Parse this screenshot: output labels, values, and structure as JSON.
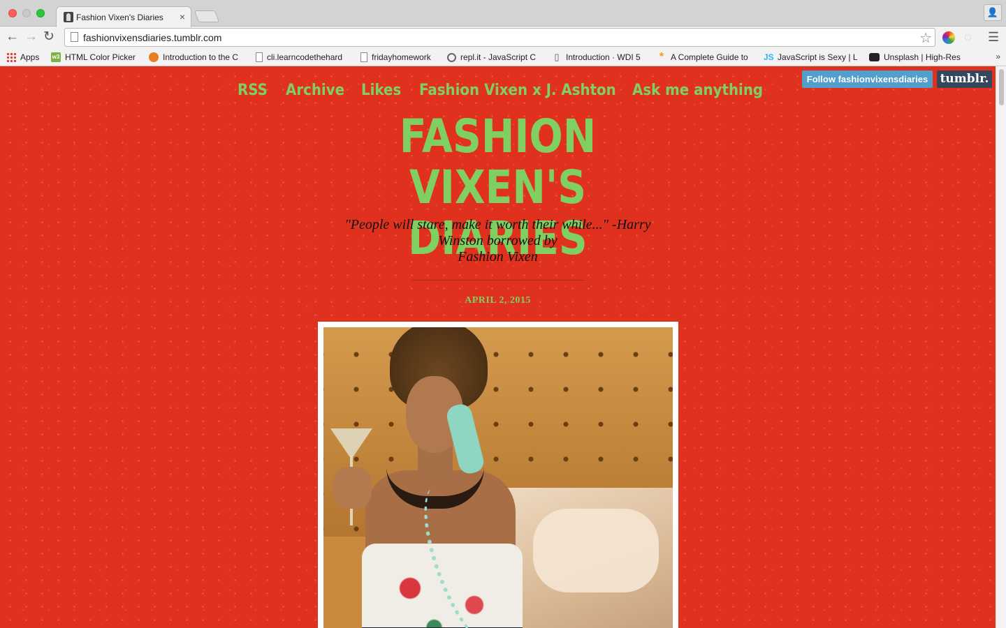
{
  "browser": {
    "tab_title": "Fashion Vixen's Diaries",
    "tab_close": "×",
    "url": "fashionvixensdiaries.tumblr.com",
    "back_glyph": "←",
    "forward_glyph": "→",
    "reload_glyph": "↻",
    "star_glyph": "☆",
    "menu_glyph": "☰",
    "profile_glyph": "👤",
    "bookmarks_more": "»",
    "bookmarks": [
      {
        "label": "Apps",
        "icon": "apps-grid-icon"
      },
      {
        "label": "HTML Color Picker",
        "icon": "w3schools-icon"
      },
      {
        "label": "Introduction to the C",
        "icon": "orange-circle-icon"
      },
      {
        "label": "cli.learncodethehard",
        "icon": "page-icon"
      },
      {
        "label": "fridayhomework",
        "icon": "page-icon"
      },
      {
        "label": "repl.it - JavaScript C",
        "icon": "repl-icon"
      },
      {
        "label": "Introduction · WDI 5",
        "icon": "book-icon"
      },
      {
        "label": "A Complete Guide to",
        "icon": "asterisk-icon"
      },
      {
        "label": "JavaScript is Sexy | L",
        "icon": "js-icon"
      },
      {
        "label": "Unsplash | High-Res",
        "icon": "camera-icon"
      }
    ]
  },
  "tumblr_controls": {
    "follow_label": "Follow fashionvixensdiaries",
    "tumblr_label": "tumblr."
  },
  "blog": {
    "nav": [
      "RSS",
      "Archive",
      "Likes",
      "Fashion Vixen x J. Ashton",
      "Ask me anything"
    ],
    "title_line1": "FASHION VIXEN'S",
    "title_line2": "DIARIES",
    "description_line1": "\"People will stare, make it worth their while...\" -Harry",
    "description_line2": "Winston borrowed by",
    "description_line3": "Fashion Vixen",
    "post_date": "APRIL 2, 2015"
  },
  "colors": {
    "page_background": "#e0301e",
    "accent_green": "#7fd060",
    "follow_blue": "#529ecc",
    "tumblr_navy": "#36465d"
  }
}
